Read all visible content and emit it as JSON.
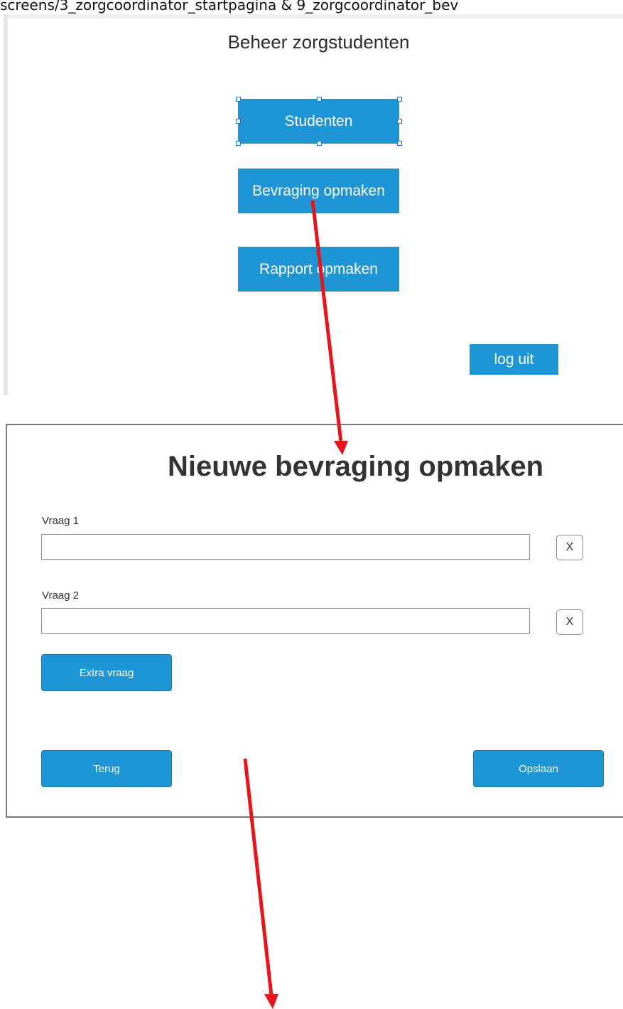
{
  "caption": "screens/3_zorgcoordinator_startpagina & 9_zorgcoordinator_bev",
  "start_page": {
    "title": "Beheer zorgstudenten",
    "buttons": {
      "studenten": "Studenten",
      "bevraging": "Bevraging opmaken",
      "rapport": "Rapport opmaken",
      "logout": "log uit"
    }
  },
  "survey_page": {
    "title": "Nieuwe bevraging opmaken",
    "questions": [
      {
        "label": "Vraag 1",
        "value": "",
        "remove": "X"
      },
      {
        "label": "Vraag 2",
        "value": "",
        "remove": "X"
      }
    ],
    "extra_button": "Extra vraag",
    "back_button": "Terug",
    "save_button": "Opslaan"
  },
  "colors": {
    "button_blue": "#1e96d6",
    "arrow_red": "#e8141b"
  }
}
